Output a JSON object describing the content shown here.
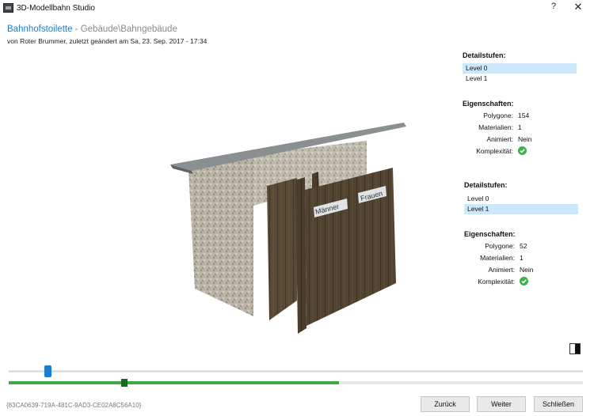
{
  "window": {
    "title": "3D-Modellbahn Studio",
    "help_label": "?",
    "close_label": "✕"
  },
  "header": {
    "model_name": "Bahnhofstoilette",
    "model_path": " - Gebäude\\Bahngebäude",
    "subtitle": "von Roter Brummer, zuletzt geändert am Sa, 23. Sep. 2017 - 17:34"
  },
  "panel1": {
    "detail_heading": "Detailstufen:",
    "levels": [
      "Level 0",
      "Level 1"
    ],
    "selected_level": "Level 0",
    "props_heading": "Eigenschaften:",
    "polygone_label": "Polygone:",
    "polygone_value": "154",
    "materialien_label": "Materialien:",
    "materialien_value": "1",
    "animiert_label": "Animiert:",
    "animiert_value": "Nein",
    "komplexitaet_label": "Komplexität:",
    "komplexitaet_icon": "check-circle-icon"
  },
  "panel2": {
    "detail_heading": "Detailstufen:",
    "levels": [
      "Level 0",
      "Level 1"
    ],
    "selected_level": "Level 1",
    "props_heading": "Eigenschaften:",
    "polygone_label": "Polygone:",
    "polygone_value": "52",
    "materialien_label": "Materialien:",
    "materialien_value": "1",
    "animiert_label": "Animiert:",
    "animiert_value": "Nein",
    "komplexitaet_label": "Komplexität:",
    "komplexitaet_icon": "check-circle-icon"
  },
  "model_signs": {
    "left": "Männer",
    "right": "Frauen"
  },
  "sliders": {
    "progress_fraction": 0.575
  },
  "footer": {
    "guid": "{83CA0639-719A-481C-9AD3-CE02A8C56A10}",
    "back_label": "Zurück",
    "next_label": "Weiter",
    "close_label": "Schließen"
  },
  "colors": {
    "accent": "#1a7fd0",
    "progress": "#3ea945",
    "selection": "#cce8fb",
    "ok": "#3fb04c"
  }
}
